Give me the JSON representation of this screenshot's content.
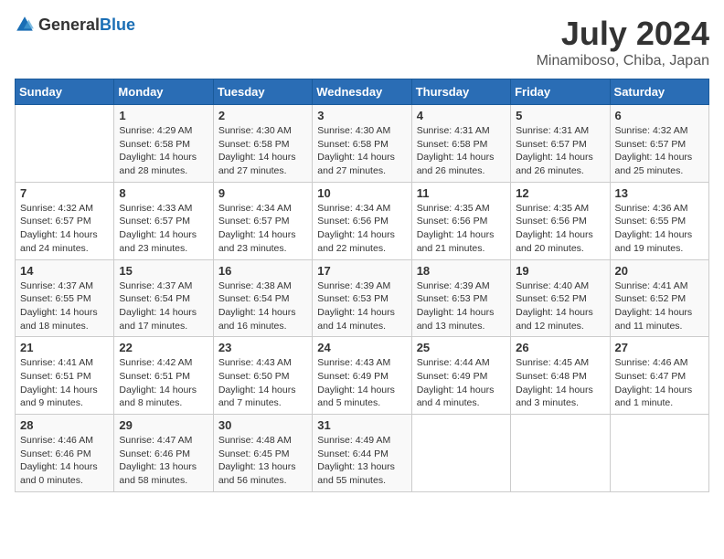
{
  "logo": {
    "general": "General",
    "blue": "Blue"
  },
  "title": "July 2024",
  "location": "Minamiboso, Chiba, Japan",
  "weekdays": [
    "Sunday",
    "Monday",
    "Tuesday",
    "Wednesday",
    "Thursday",
    "Friday",
    "Saturday"
  ],
  "weeks": [
    [
      {
        "day": "",
        "info": ""
      },
      {
        "day": "1",
        "info": "Sunrise: 4:29 AM\nSunset: 6:58 PM\nDaylight: 14 hours and 28 minutes."
      },
      {
        "day": "2",
        "info": "Sunrise: 4:30 AM\nSunset: 6:58 PM\nDaylight: 14 hours and 27 minutes."
      },
      {
        "day": "3",
        "info": "Sunrise: 4:30 AM\nSunset: 6:58 PM\nDaylight: 14 hours and 27 minutes."
      },
      {
        "day": "4",
        "info": "Sunrise: 4:31 AM\nSunset: 6:58 PM\nDaylight: 14 hours and 26 minutes."
      },
      {
        "day": "5",
        "info": "Sunrise: 4:31 AM\nSunset: 6:57 PM\nDaylight: 14 hours and 26 minutes."
      },
      {
        "day": "6",
        "info": "Sunrise: 4:32 AM\nSunset: 6:57 PM\nDaylight: 14 hours and 25 minutes."
      }
    ],
    [
      {
        "day": "7",
        "info": "Sunrise: 4:32 AM\nSunset: 6:57 PM\nDaylight: 14 hours and 24 minutes."
      },
      {
        "day": "8",
        "info": "Sunrise: 4:33 AM\nSunset: 6:57 PM\nDaylight: 14 hours and 23 minutes."
      },
      {
        "day": "9",
        "info": "Sunrise: 4:34 AM\nSunset: 6:57 PM\nDaylight: 14 hours and 23 minutes."
      },
      {
        "day": "10",
        "info": "Sunrise: 4:34 AM\nSunset: 6:56 PM\nDaylight: 14 hours and 22 minutes."
      },
      {
        "day": "11",
        "info": "Sunrise: 4:35 AM\nSunset: 6:56 PM\nDaylight: 14 hours and 21 minutes."
      },
      {
        "day": "12",
        "info": "Sunrise: 4:35 AM\nSunset: 6:56 PM\nDaylight: 14 hours and 20 minutes."
      },
      {
        "day": "13",
        "info": "Sunrise: 4:36 AM\nSunset: 6:55 PM\nDaylight: 14 hours and 19 minutes."
      }
    ],
    [
      {
        "day": "14",
        "info": "Sunrise: 4:37 AM\nSunset: 6:55 PM\nDaylight: 14 hours and 18 minutes."
      },
      {
        "day": "15",
        "info": "Sunrise: 4:37 AM\nSunset: 6:54 PM\nDaylight: 14 hours and 17 minutes."
      },
      {
        "day": "16",
        "info": "Sunrise: 4:38 AM\nSunset: 6:54 PM\nDaylight: 14 hours and 16 minutes."
      },
      {
        "day": "17",
        "info": "Sunrise: 4:39 AM\nSunset: 6:53 PM\nDaylight: 14 hours and 14 minutes."
      },
      {
        "day": "18",
        "info": "Sunrise: 4:39 AM\nSunset: 6:53 PM\nDaylight: 14 hours and 13 minutes."
      },
      {
        "day": "19",
        "info": "Sunrise: 4:40 AM\nSunset: 6:52 PM\nDaylight: 14 hours and 12 minutes."
      },
      {
        "day": "20",
        "info": "Sunrise: 4:41 AM\nSunset: 6:52 PM\nDaylight: 14 hours and 11 minutes."
      }
    ],
    [
      {
        "day": "21",
        "info": "Sunrise: 4:41 AM\nSunset: 6:51 PM\nDaylight: 14 hours and 9 minutes."
      },
      {
        "day": "22",
        "info": "Sunrise: 4:42 AM\nSunset: 6:51 PM\nDaylight: 14 hours and 8 minutes."
      },
      {
        "day": "23",
        "info": "Sunrise: 4:43 AM\nSunset: 6:50 PM\nDaylight: 14 hours and 7 minutes."
      },
      {
        "day": "24",
        "info": "Sunrise: 4:43 AM\nSunset: 6:49 PM\nDaylight: 14 hours and 5 minutes."
      },
      {
        "day": "25",
        "info": "Sunrise: 4:44 AM\nSunset: 6:49 PM\nDaylight: 14 hours and 4 minutes."
      },
      {
        "day": "26",
        "info": "Sunrise: 4:45 AM\nSunset: 6:48 PM\nDaylight: 14 hours and 3 minutes."
      },
      {
        "day": "27",
        "info": "Sunrise: 4:46 AM\nSunset: 6:47 PM\nDaylight: 14 hours and 1 minute."
      }
    ],
    [
      {
        "day": "28",
        "info": "Sunrise: 4:46 AM\nSunset: 6:46 PM\nDaylight: 14 hours and 0 minutes."
      },
      {
        "day": "29",
        "info": "Sunrise: 4:47 AM\nSunset: 6:46 PM\nDaylight: 13 hours and 58 minutes."
      },
      {
        "day": "30",
        "info": "Sunrise: 4:48 AM\nSunset: 6:45 PM\nDaylight: 13 hours and 56 minutes."
      },
      {
        "day": "31",
        "info": "Sunrise: 4:49 AM\nSunset: 6:44 PM\nDaylight: 13 hours and 55 minutes."
      },
      {
        "day": "",
        "info": ""
      },
      {
        "day": "",
        "info": ""
      },
      {
        "day": "",
        "info": ""
      }
    ]
  ]
}
